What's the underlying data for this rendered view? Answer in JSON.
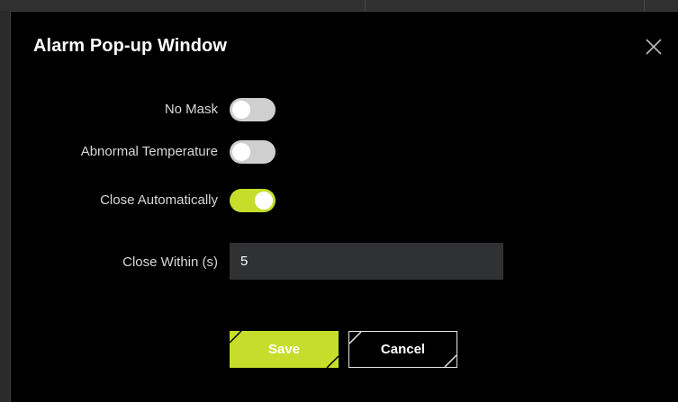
{
  "dialog": {
    "title": "Alarm Pop-up Window",
    "close_icon": "close-icon"
  },
  "settings": {
    "no_mask": {
      "label": "No Mask",
      "enabled": false
    },
    "abnormal_temperature": {
      "label": "Abnormal Temperature",
      "enabled": false
    },
    "close_automatically": {
      "label": "Close Automatically",
      "enabled": true
    },
    "close_within": {
      "label": "Close Within (s)",
      "value": "5"
    }
  },
  "actions": {
    "save_label": "Save",
    "cancel_label": "Cancel"
  },
  "colors": {
    "accent": "#c6de2b",
    "toggle_off": "#cfcfcf",
    "background": "#000000",
    "input_bg": "#2f3133"
  }
}
